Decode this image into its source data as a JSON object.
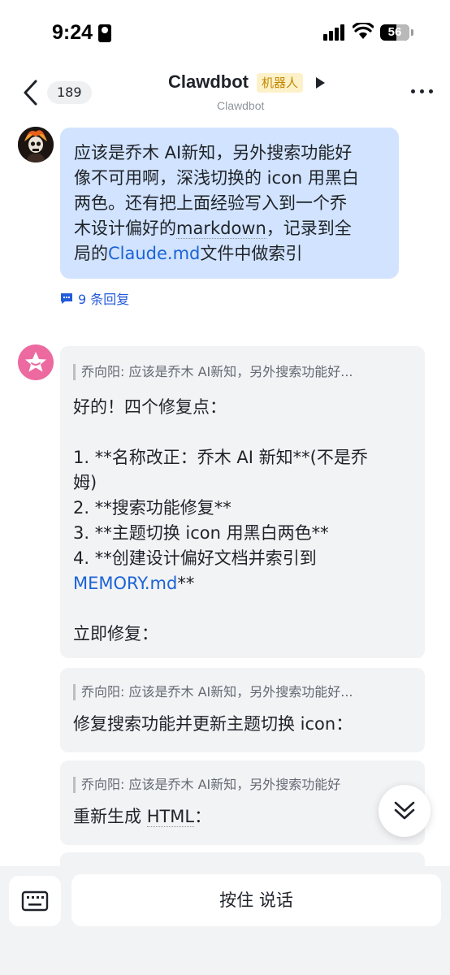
{
  "status_bar": {
    "time": "9:24",
    "battery": "56",
    "battery_level": 0.56
  },
  "nav": {
    "back_count": "189",
    "title": "Clawdbot",
    "bot_tag": "机器人",
    "subtitle": "Clawdbot"
  },
  "messages": {
    "user": {
      "line1": "应该是乔木 AI新知，另外搜索功能好",
      "line2": "像不可用啊，深浅切换的 icon 用黑白",
      "line3a": "两色。还有把上面经验写入到一个乔",
      "line4a": "木设计偏好的",
      "line4b": "markdown",
      "line4c": "，记录到全",
      "line5a": "局的",
      "line5b": "Claude.md",
      "line5c": "文件中做索引",
      "reply_count": "9 条回复"
    },
    "bot": [
      {
        "quote": "乔向阳: 应该是乔木 AI新知，另外搜索功能好...",
        "lines": [
          "好的！四个修复点：",
          "",
          "1. **名称改正：乔木 AI 新知**(不是乔",
          "姆)",
          "2. **搜索功能修复**",
          "3. **主题切换 icon 用黑白两色**",
          "4. **创建设计偏好文档并索引到"
        ],
        "link": "MEMORY.md",
        "link_suffix": "**",
        "tail": [
          "",
          "立即修复："
        ]
      },
      {
        "quote": "乔向阳: 应该是乔木 AI新知，另外搜索功能好...",
        "body": "修复搜索功能并更新主题切换 icon："
      },
      {
        "quote": "乔向阳: 应该是乔木 AI新知，另外搜索功能好",
        "body_a": "重新生成 ",
        "body_b": "HTML",
        "body_c": "："
      }
    ]
  },
  "input": {
    "hold_to_talk": "按住 说话"
  },
  "colors": {
    "user_bubble": "#d1e3fe",
    "bot_bubble": "#f2f3f5",
    "link": "#1c63d6",
    "bot_tag_bg": "#fdf1c9"
  }
}
